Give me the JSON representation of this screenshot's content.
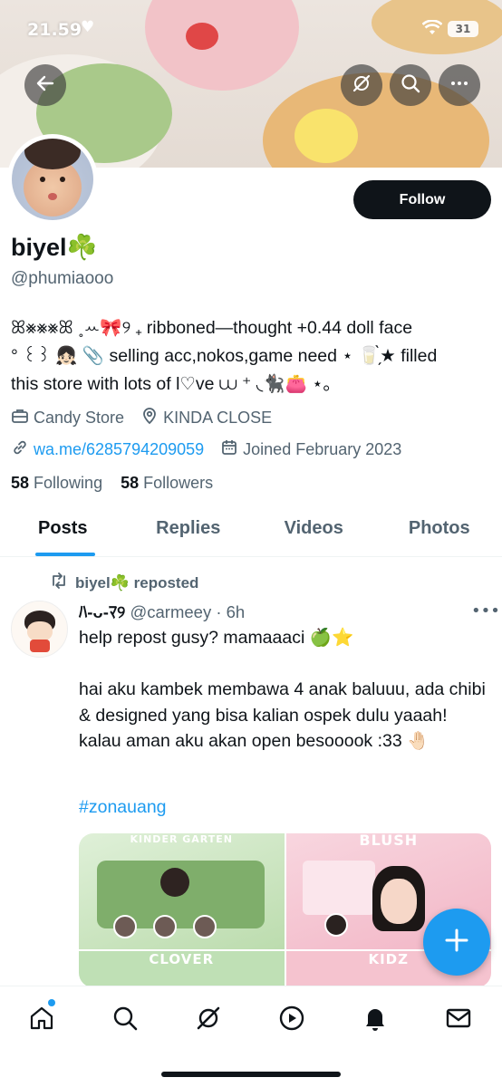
{
  "status_bar": {
    "time": "21.59",
    "battery": "31"
  },
  "profile": {
    "name": "biyel☘️",
    "handle": "@phumiaooo",
    "follow_label": "Follow",
    "bio": "ꕤ⨳⨳⨳ꕤ ˳ꕀ🎀୨ ₊ ribboned—thought +0.44 doll face\n° ꒰꒱ 👧🏻 📎 selling acc,nokos,game need ⋆ 🥛̗̀★ filled\nthis store with lots of l♡ve ⩊ ⁺ ◟🐈‍⬛👛 ⋆｡",
    "category": "Candy Store",
    "location": "KINDA CLOSE",
    "link": "wa.me/6285794209059",
    "joined": "Joined February 2023",
    "following_count": "58",
    "following_label": "Following",
    "followers_count": "58",
    "followers_label": "Followers"
  },
  "tabs": [
    {
      "label": "Posts"
    },
    {
      "label": "Replies"
    },
    {
      "label": "Videos"
    },
    {
      "label": "Photos"
    }
  ],
  "post": {
    "repost_label": "biyel☘️ reposted",
    "author_name": "ﾊ-ᴗ-ﾏ୨",
    "author_handle": "@carmeey",
    "time": "· 6h",
    "text": "help repost gusy? mamaaaci 🍏⭐\n\nhai aku kambek membawa 4 anak baluuu, ada chibi & designed yang bisa kalian ospek dulu yaaah! kalau aman aku akan open besooook :33 🤚🏻",
    "hashtag": "#zonauang",
    "media": [
      {
        "label": "KINDER GARTEN"
      },
      {
        "label": "BLUSH"
      },
      {
        "label": "CLOVER"
      },
      {
        "label": "KIDZ"
      }
    ]
  },
  "colors": {
    "accent": "#1d9bf0",
    "text": "#0f1419",
    "muted": "#536471"
  },
  "icons": {
    "back": "back-arrow-icon",
    "grok": "grok-icon",
    "search": "search-icon",
    "more": "more-icon",
    "nav": [
      "home-icon",
      "search-icon",
      "grok-icon",
      "video-icon",
      "bell-icon",
      "mail-icon"
    ]
  }
}
